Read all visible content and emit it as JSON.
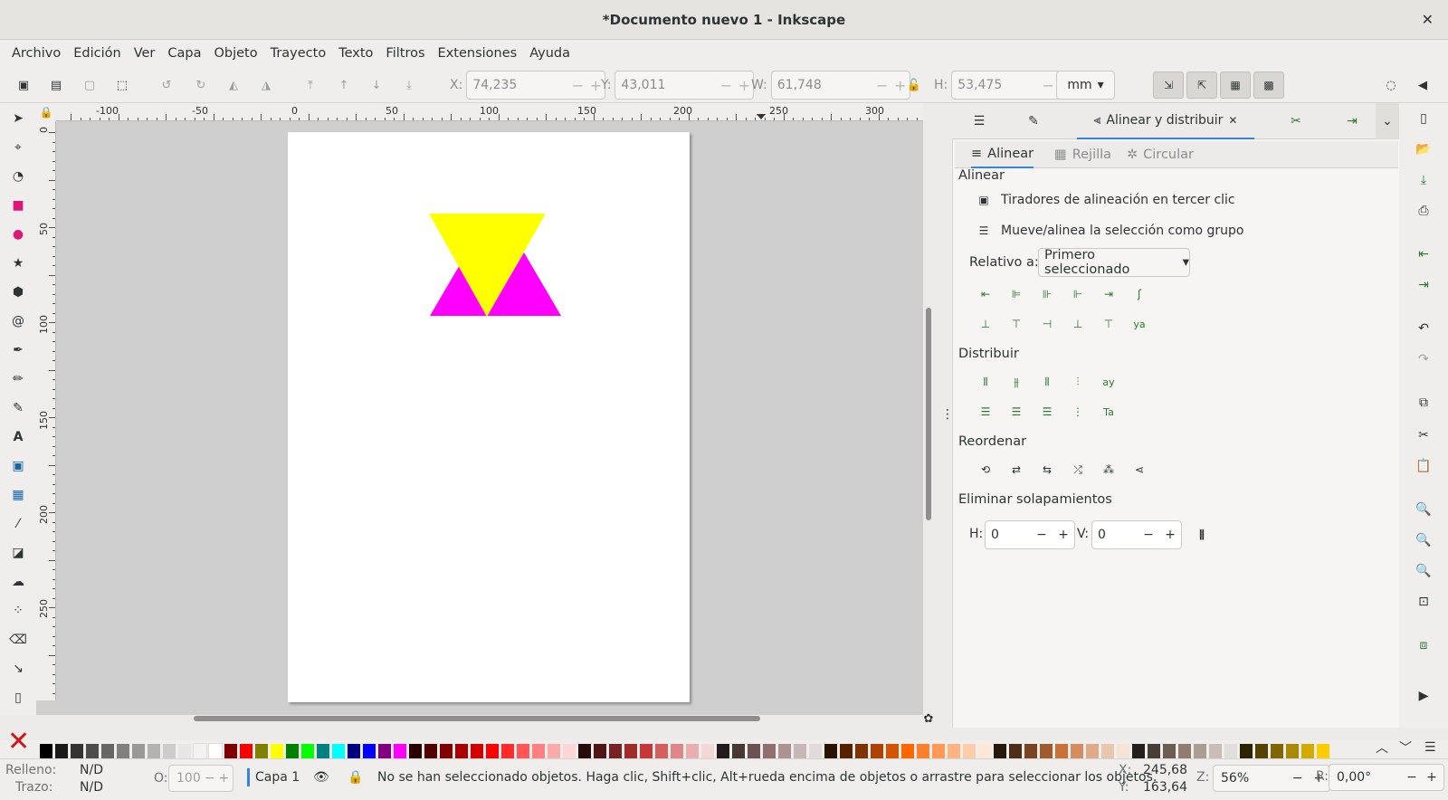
{
  "window": {
    "title": "*Documento nuevo 1 - Inkscape",
    "close_glyph": "✕"
  },
  "menu": [
    "Archivo",
    "Edición",
    "Ver",
    "Capa",
    "Objeto",
    "Trayecto",
    "Texto",
    "Filtros",
    "Extensiones",
    "Ayuda"
  ],
  "toolbar": {
    "x_label": "X:",
    "x_value": "74,235",
    "y_label": "Y:",
    "y_value": "43,011",
    "w_label": "W:",
    "w_value": "61,748",
    "h_label": "H:",
    "h_value": "53,475",
    "unit": "mm"
  },
  "ruler": {
    "h_labels": [
      "-100",
      "-50",
      "0",
      "50",
      "100",
      "150",
      "200",
      "250",
      "300"
    ],
    "v_labels": [
      "0",
      "50",
      "100",
      "150",
      "200",
      "250"
    ]
  },
  "canvas": {
    "page_color": "#ffffff",
    "shapes": [
      {
        "name": "magenta-triangle-left",
        "color": "#ff00ff"
      },
      {
        "name": "magenta-triangle-right",
        "color": "#ff00ff"
      },
      {
        "name": "yellow-triangle-inverted",
        "color": "#ffff00"
      }
    ]
  },
  "dock": {
    "active_tab": "Alinear y distribuir",
    "subtabs": [
      "Alinear",
      "Rejilla",
      "Circular"
    ],
    "align_heading": "Alinear",
    "option1": "Tiradores de alineación en tercer clic",
    "option2": "Mueve/alinea la selección como grupo",
    "relative_label": "Relativo a:",
    "relative_value": "Primero seleccionado",
    "distribute_heading": "Distribuir",
    "reorder_heading": "Reordenar",
    "overlap_heading": "Eliminar solapamientos",
    "h_label": "H:",
    "h_value": "0",
    "v_label": "V:",
    "v_value": "0"
  },
  "palette": {
    "colors": [
      "#000000",
      "#1a1a1a",
      "#333333",
      "#4d4d4d",
      "#666666",
      "#808080",
      "#999999",
      "#b3b3b3",
      "#cccccc",
      "#e6e6e6",
      "#f2f2f2",
      "#ffffff",
      "#800000",
      "#ff0000",
      "#808000",
      "#ffff00",
      "#008000",
      "#00ff00",
      "#008080",
      "#00ffff",
      "#000080",
      "#0000ff",
      "#800080",
      "#ff00ff",
      "#2b0000",
      "#550000",
      "#800000",
      "#aa0000",
      "#d40000",
      "#ff0000",
      "#ff2a2a",
      "#ff5555",
      "#ff8080",
      "#ffaaaa",
      "#ffd5d5",
      "#280b0b",
      "#501616",
      "#782121",
      "#a02c2c",
      "#c83737",
      "#d35f5f",
      "#de8787",
      "#e9afaf",
      "#f4d7d7",
      "#241c1c",
      "#483737",
      "#6c5353",
      "#916f6f",
      "#ac9393",
      "#c8b7b7",
      "#e3dbdb",
      "#2b1100",
      "#552200",
      "#803300",
      "#aa4400",
      "#d45500",
      "#ff6600",
      "#ff7f2a",
      "#ff9955",
      "#ffb380",
      "#ffccaa",
      "#ffe6d5",
      "#28170b",
      "#502d16",
      "#784421",
      "#a05a2c",
      "#c87137",
      "#d38d5f",
      "#deaa87",
      "#e9c6af",
      "#f4e3d7",
      "#241f1c",
      "#483e37",
      "#6c5d53",
      "#917c6f",
      "#ac9d93",
      "#c8beb7",
      "#e3dedb",
      "#2b2200",
      "#554400",
      "#806600",
      "#aa8800",
      "#d4aa00",
      "#ffcc00"
    ]
  },
  "status": {
    "fill_label": "Relleno:",
    "fill_value": "N/D",
    "stroke_label": "Trazo:",
    "stroke_value": "N/D",
    "opacity_label": "O:",
    "opacity_value": "100",
    "layer": "Capa 1",
    "message": "No se han seleccionado objetos. Haga clic, Shift+clic, Alt+rueda encima de objetos o arrastre para seleccionar los objetos.",
    "cx_label": "X:",
    "cx_value": "245,68",
    "cy_label": "Y:",
    "cy_value": "163,64",
    "zoom_label": "Z:",
    "zoom_value": "56%",
    "rot_label": "R:",
    "rot_value": "0,00°"
  }
}
